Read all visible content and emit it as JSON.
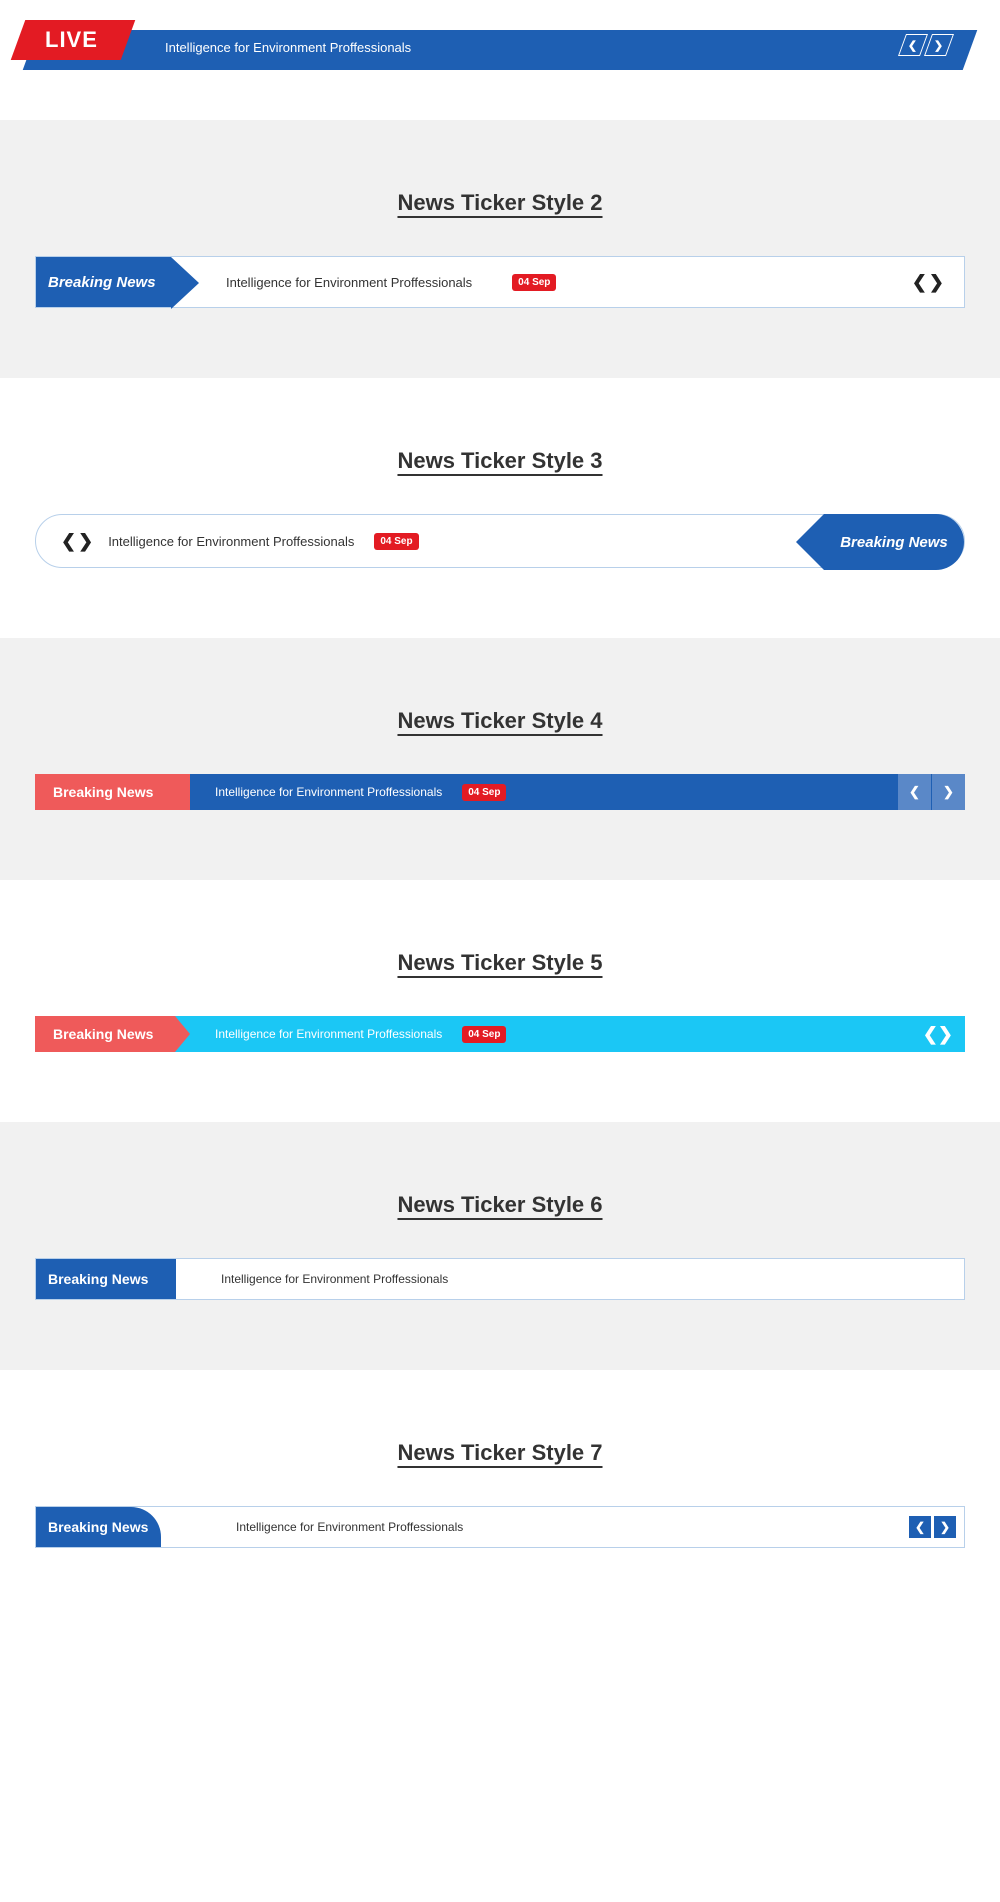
{
  "ticker": {
    "headline": "Intelligence for Environment Proffessionals",
    "date_badge": "04 Sep",
    "live_label": "LIVE",
    "breaking_label": "Breaking News"
  },
  "sections": {
    "s2_title": "News Ticker Style 2",
    "s3_title": "News Ticker Style 3",
    "s4_title": "News Ticker Style 4",
    "s5_title": "News Ticker Style 5",
    "s6_title": "News Ticker Style 6",
    "s7_title": "News Ticker Style 7"
  }
}
